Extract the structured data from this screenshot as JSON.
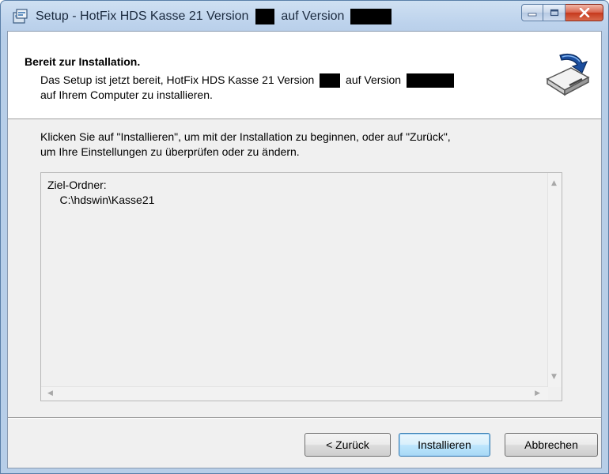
{
  "window": {
    "title_prefix": "Setup - HotFix HDS Kasse 21 Version",
    "title_middle": "auf Version",
    "app_icon": "setup-icon",
    "controls": {
      "minimize_icon": "minimize-icon",
      "maximize_icon": "maximize-icon",
      "close_icon": "close-icon"
    }
  },
  "header": {
    "title": "Bereit zur Installation.",
    "desc_part1": "Das Setup ist jetzt bereit, HotFix HDS Kasse 21 Version",
    "desc_part2": "auf Version",
    "desc_line2": "auf Ihrem Computer zu installieren.",
    "image_icon": "wizard-disk-icon"
  },
  "body": {
    "line1": "Klicken Sie auf \"Installieren\", um mit der Installation zu beginnen, oder auf \"Zurück\",",
    "line2": "um Ihre Einstellungen zu überprüfen oder zu ändern."
  },
  "memo": {
    "label": "Ziel-Ordner:",
    "value": "    C:\\hdswin\\Kasse21"
  },
  "buttons": {
    "back": "< Zurück",
    "install": "Installieren",
    "cancel": "Abbrechen"
  },
  "colors": {
    "titlebar": "#bcd2ec",
    "close": "#c6381c",
    "default_button": "#3c7fb1"
  }
}
